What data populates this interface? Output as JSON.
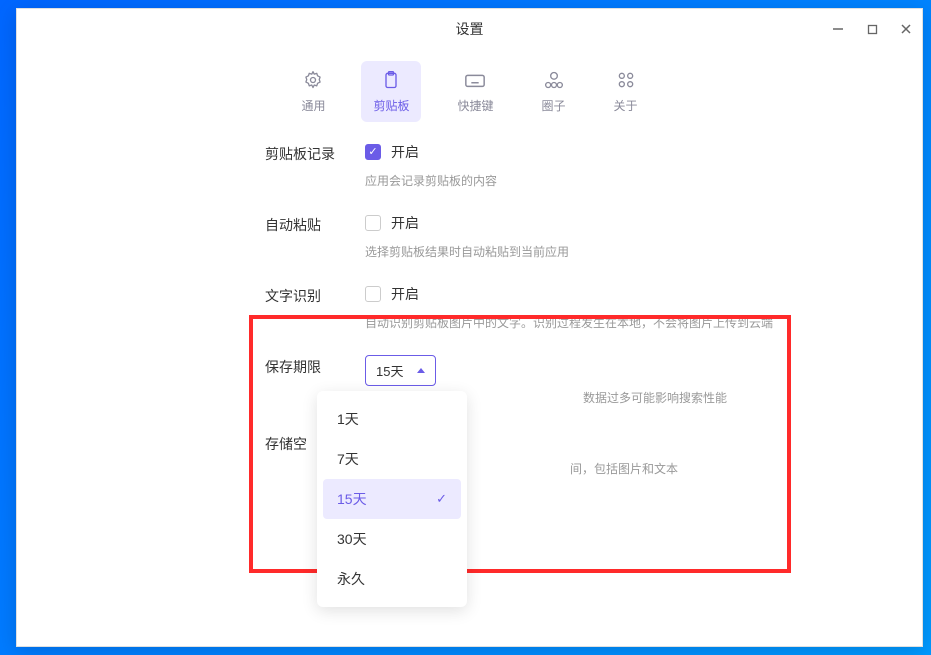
{
  "window": {
    "title": "设置"
  },
  "tabs": [
    {
      "id": "general",
      "label": "通用",
      "active": false
    },
    {
      "id": "clipboard",
      "label": "剪贴板",
      "active": true
    },
    {
      "id": "shortcut",
      "label": "快捷键",
      "active": false
    },
    {
      "id": "circle",
      "label": "圈子",
      "active": false
    },
    {
      "id": "about",
      "label": "关于",
      "active": false
    }
  ],
  "settings": {
    "clipboard_record": {
      "label": "剪贴板记录",
      "checkbox_label": "开启",
      "checked": true,
      "hint": "应用会记录剪贴板的内容"
    },
    "auto_paste": {
      "label": "自动粘贴",
      "checkbox_label": "开启",
      "checked": false,
      "hint": "选择剪贴板结果时自动粘贴到当前应用"
    },
    "text_recognition": {
      "label": "文字识别",
      "checkbox_label": "开启",
      "checked": false,
      "hint": "自动识别剪贴板图片中的文字。识别过程发生在本地，不会将图片上传到云端"
    },
    "retention": {
      "label": "保存期限",
      "selected": "15天",
      "hint_partial": "数据过多可能影响搜索性能",
      "options": [
        "1天",
        "7天",
        "15天",
        "30天",
        "永久"
      ]
    },
    "storage": {
      "label_partial": "存储空",
      "hint_partial": "间，包括图片和文本"
    }
  }
}
